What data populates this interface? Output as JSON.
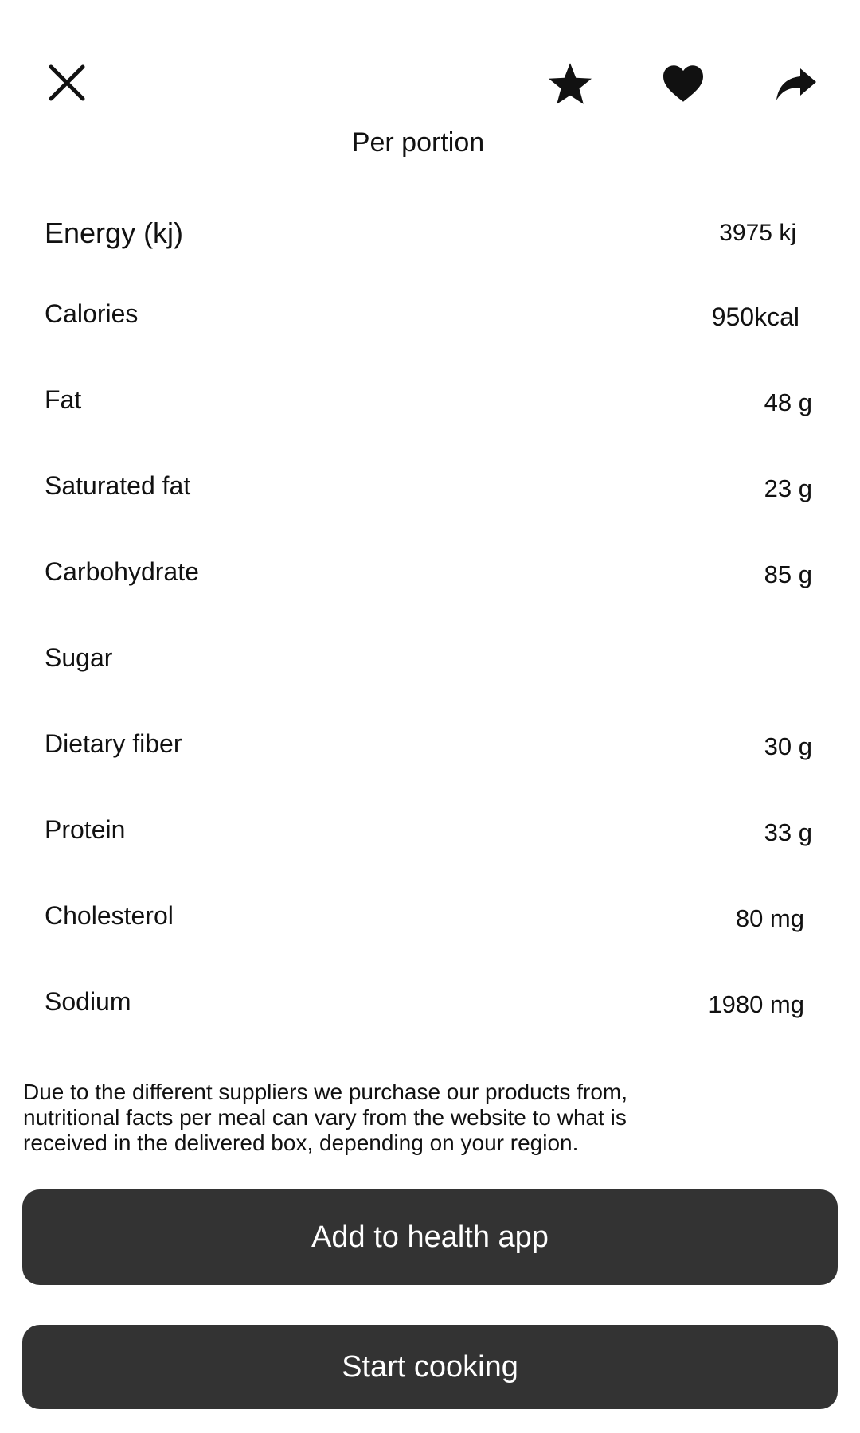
{
  "header": {
    "icons": {
      "close": "close-icon",
      "favorite_star": "star-icon",
      "like": "heart-icon",
      "share": "share-icon"
    },
    "subtitle": "Per portion"
  },
  "nutrition": {
    "rows": [
      {
        "label": "Energy (kj)",
        "value": "3975 kj"
      },
      {
        "label": "Calories",
        "value": "950kcal"
      },
      {
        "label": "Fat",
        "value": "48 g"
      },
      {
        "label": "Saturated fat",
        "value": "23 g"
      },
      {
        "label": "Carbohydrate",
        "value": "85 g"
      },
      {
        "label": "Sugar",
        "value": ""
      },
      {
        "label": "Dietary fiber",
        "value": "30 g"
      },
      {
        "label": "Protein",
        "value": "33 g"
      },
      {
        "label": "Cholesterol",
        "value": "80 mg"
      },
      {
        "label": "Sodium",
        "value": "1980 mg"
      }
    ]
  },
  "disclaimer": {
    "line1": "Due to the different suppliers we purchase our products from,",
    "line2": "nutritional facts per meal can vary from the website to what is",
    "line3": "received in the delivered box, depending on your region."
  },
  "actions": {
    "add_to_health_label": "Add to health app",
    "start_cooking_label": "Start cooking"
  },
  "colors": {
    "button_bg": "#333333",
    "button_text": "#ffffff",
    "text": "#111111"
  }
}
